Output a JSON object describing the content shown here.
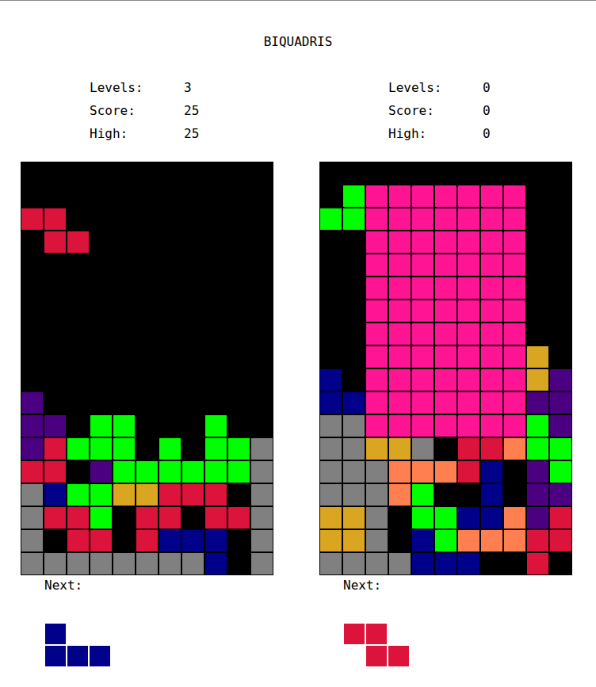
{
  "title": "BIQUADRIS",
  "colors": {
    "R": "#dc143c",
    "G": "#00ff00",
    "P": "#4b0082",
    "X": "#808080",
    "B": "#00008b",
    "O": "#daa520",
    "K": "#ff1493",
    "S": "#ff7f50"
  },
  "players": [
    {
      "stats": [
        {
          "label": "Levels:",
          "value": "3"
        },
        {
          "label": "Score:",
          "value": "25"
        },
        {
          "label": "High:",
          "value": "25"
        }
      ],
      "board": {
        "rows": [
          "...........",
          "...........",
          "RR.........",
          ".RR........",
          "...........",
          "...........",
          "...........",
          "...........",
          "...........",
          "...........",
          "P..........",
          "PP.GG...G..",
          "PRGGG.G.GGX",
          "RR.PGGGGGGX",
          "XBGGOORRR.X",
          "XRRG.RR.RRX",
          "X.RR.RBBB.X",
          "XXXXXXXXB.X"
        ]
      },
      "next": {
        "label": "Next:",
        "shape": [
          "B..",
          "BBB"
        ]
      }
    },
    {
      "stats": [
        {
          "label": "Levels:",
          "value": "0"
        },
        {
          "label": "Score:",
          "value": "0"
        },
        {
          "label": "High:",
          "value": "0"
        }
      ],
      "board": {
        "rows": [
          "...........",
          ".GKKKKKKK..",
          "GGKKKKKKK..",
          "..KKKKKKK..",
          "..KKKKKKK..",
          "..KKKKKKK..",
          "..KKKKKKK..",
          "..KKKKKKK..",
          "..KKKKKKKO.",
          "B.KKKKKKKOP",
          "BBKKKKKKKPP",
          "XXKKKKKKKGP",
          "XXOOX.RRSGG",
          "XXXSSSRB.PG",
          "XXXSG..B.PP",
          "OOX.GGBBSPR",
          "OOX.BGSSSRR",
          "XXXXBBB..R."
        ]
      },
      "next": {
        "label": "Next:",
        "shape": [
          "RR.",
          ".RR"
        ]
      }
    }
  ]
}
